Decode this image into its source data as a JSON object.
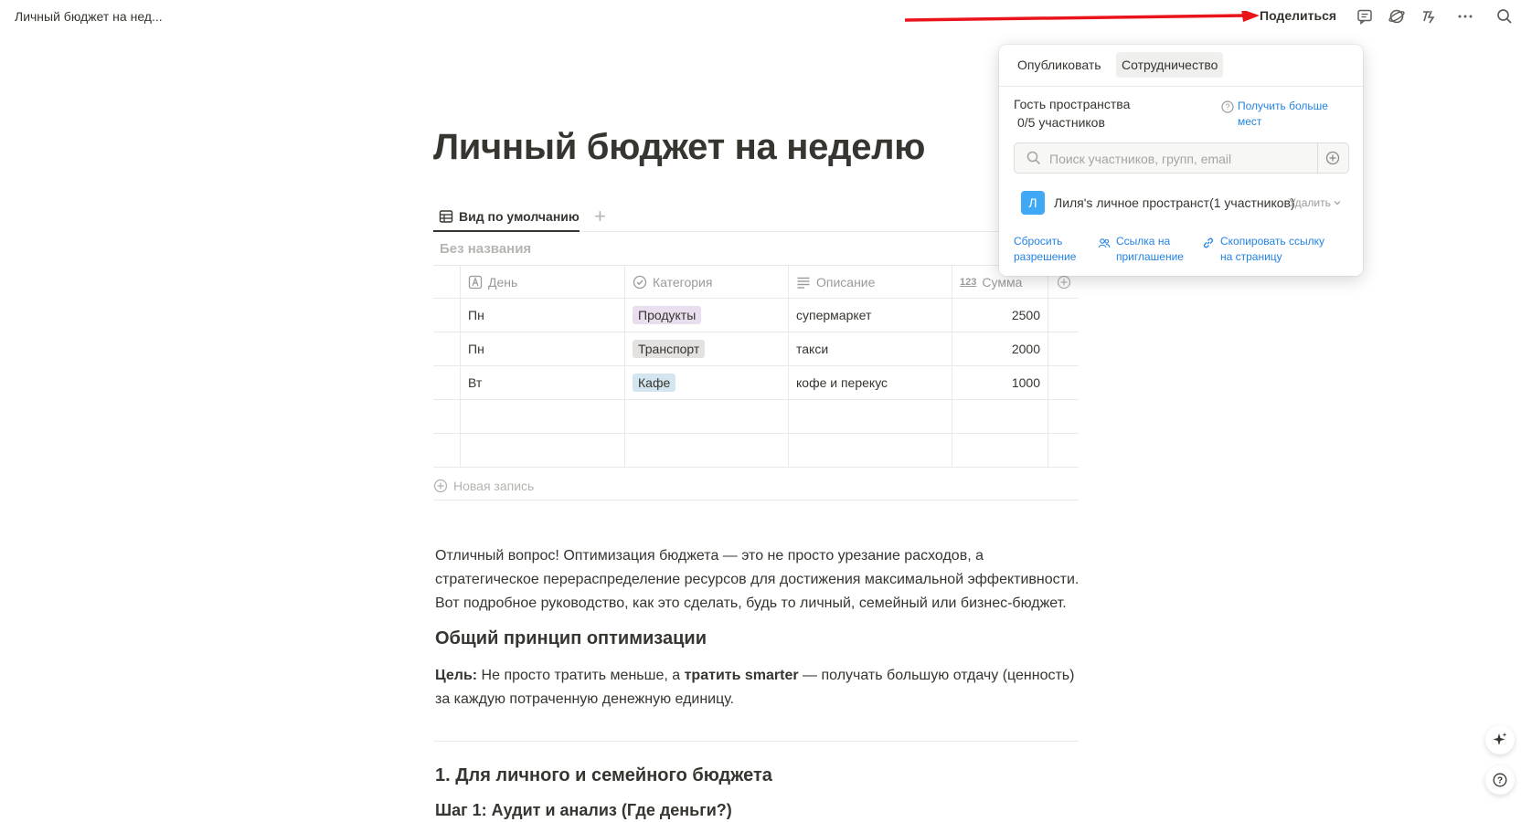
{
  "topbar": {
    "breadcrumb": "Личный бюджет на нед...",
    "share_label": "Поделиться",
    "icons": [
      "comment-icon",
      "updates-icon",
      "ai-icon",
      "more-icon",
      "search-icon"
    ]
  },
  "page": {
    "title": "Личный бюджет на неделю",
    "view_tab_label": "Вид по умолчанию",
    "table_name": "Без названия",
    "columns": [
      "День",
      "Категория",
      "Описание",
      "Сумма"
    ],
    "rows": [
      {
        "day": "Пн",
        "category": "Продукты",
        "category_color": "#e8deee",
        "description": "супермаркет",
        "amount": "2500"
      },
      {
        "day": "Пн",
        "category": "Транспорт",
        "category_color": "#e3e2e0",
        "description": "такси",
        "amount": "2000"
      },
      {
        "day": "Вт",
        "category": "Кафе",
        "category_color": "#d3e5ef",
        "description": "кофе и перекус",
        "amount": "1000"
      }
    ],
    "new_record_label": "Новая запись"
  },
  "content": {
    "intro": "Отличный вопрос! Оптимизация бюджета — это не просто урезание расходов, а стратегическое перераспределение ресурсов для достижения максимальной эффективности. Вот подробное руководство, как это сделать, будь то личный, семейный или бизнес-бюджет.",
    "heading_1": "Общий принцип оптимизации",
    "goal_label": "Цель:",
    "goal_text_1": " Не просто тратить меньше, а ",
    "goal_bold": "тратить smarter",
    "goal_text_2": " — получать большую отдачу (ценность) за каждую потраченную денежную единицу.",
    "heading_2": "1. Для личного и семейного бюджета",
    "heading_3": "Шаг 1: Аудит и анализ (Где деньги?)"
  },
  "share_popover": {
    "tab_publish": "Опубликовать",
    "tab_collab": "Сотрудничество",
    "guest_title": "Гость пространства",
    "guest_count": "0/5 участников",
    "more_seats": "Получить больше мест",
    "search_placeholder": "Поиск участников, групп, email",
    "member_avatar": "Л",
    "member_name": "Лиля's личное пространст(1 участников)",
    "member_remove": "Удалить",
    "reset_permission": "Сбросить разрешение",
    "invite_link": "Ссылка на приглашение",
    "copy_link": "Скопировать ссылку на страницу"
  },
  "accent_color": "#2383e2",
  "annotation_arrow_color": "#e8141a"
}
